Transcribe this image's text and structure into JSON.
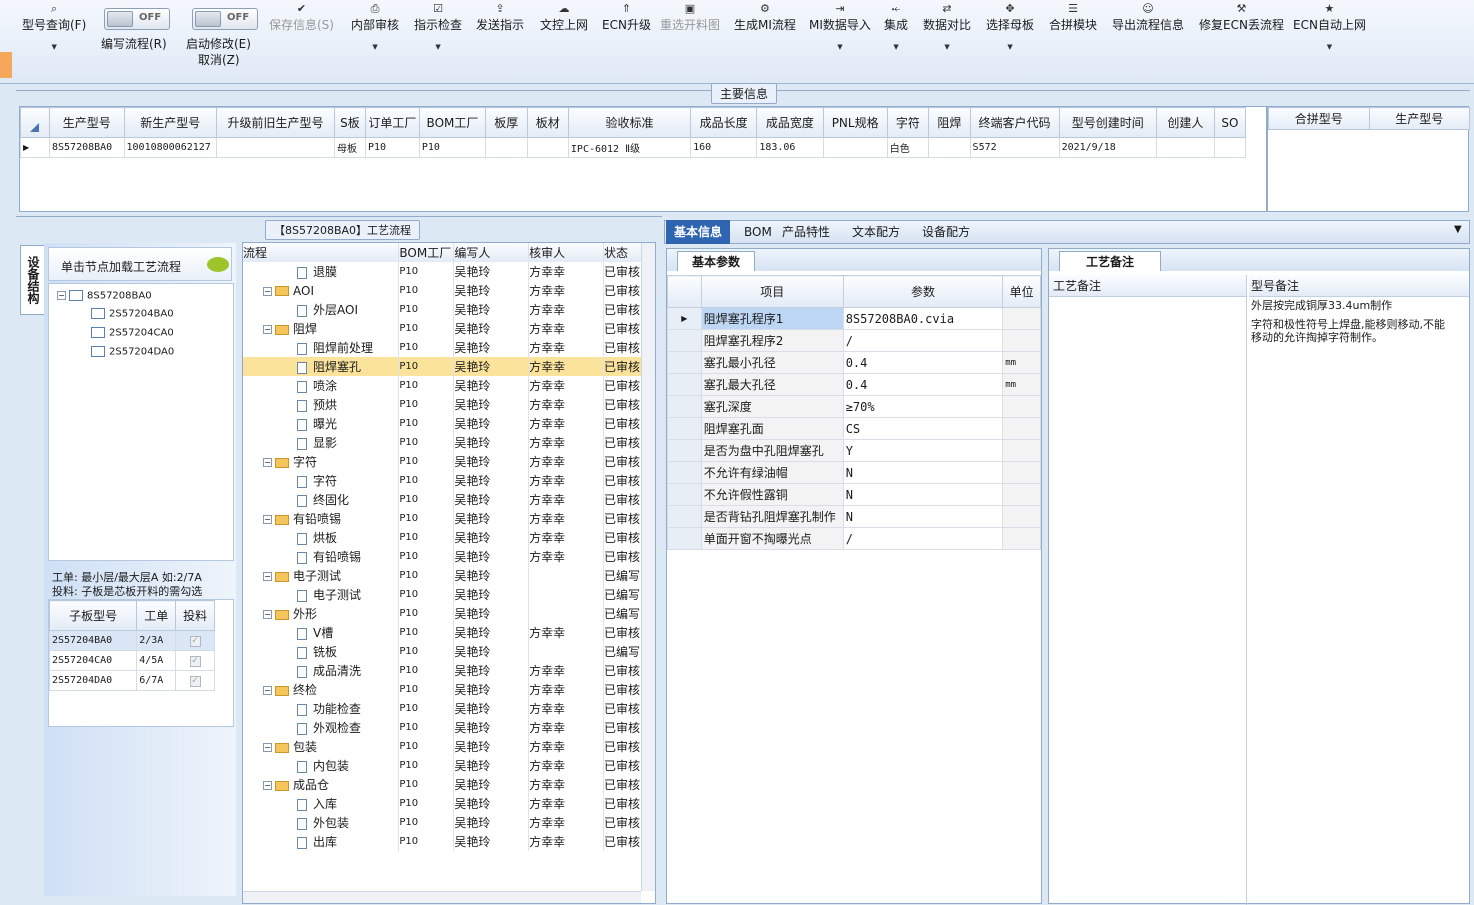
{
  "toolbar": {
    "buttons": [
      {
        "label": "型号查询(F)",
        "icon": "search-icon",
        "dropdown": true,
        "disabled": false
      },
      {
        "label": "保存信息(S)",
        "icon": "check-icon",
        "dropdown": false,
        "disabled": true
      },
      {
        "label": "内部审核",
        "icon": "printer-icon",
        "dropdown": true,
        "disabled": false
      },
      {
        "label": "指示检查",
        "icon": "checkbox-icon",
        "dropdown": true,
        "disabled": false
      },
      {
        "label": "发送指示",
        "icon": "upload-user-icon",
        "dropdown": false,
        "disabled": false
      },
      {
        "label": "文控上网",
        "icon": "cloud-upload-icon",
        "dropdown": false,
        "disabled": false
      },
      {
        "label": "ECN升级",
        "icon": "upgrade-icon",
        "dropdown": false,
        "disabled": false
      },
      {
        "label": "重选开料图",
        "icon": "image-icon",
        "dropdown": false,
        "disabled": true
      },
      {
        "label": "生成MI流程",
        "icon": "gears-icon",
        "dropdown": false,
        "disabled": false
      },
      {
        "label": "MI数据导入",
        "icon": "import-icon",
        "dropdown": true,
        "disabled": false
      },
      {
        "label": "集成",
        "icon": "merge-icon",
        "dropdown": true,
        "disabled": false
      },
      {
        "label": "数据对比",
        "icon": "compare-icon",
        "dropdown": true,
        "disabled": false
      },
      {
        "label": "选择母板",
        "icon": "select-icon",
        "dropdown": true,
        "disabled": false
      },
      {
        "label": "合拼模块",
        "icon": "list-icon",
        "dropdown": false,
        "disabled": false
      },
      {
        "label": "导出流程信息",
        "icon": "smile-icon",
        "dropdown": false,
        "disabled": false
      },
      {
        "label": "修复ECN丢流程",
        "icon": "wrench-icon",
        "dropdown": false,
        "disabled": false
      },
      {
        "label": "ECN自动上网",
        "icon": "star-icon",
        "dropdown": true,
        "disabled": false
      }
    ],
    "toggle1": {
      "state": "OFF",
      "label": "编写流程(R)"
    },
    "toggle2": {
      "state": "OFF",
      "label": "启动修改(E)",
      "sub": "取消(Z)"
    }
  },
  "main_info": {
    "title": "主要信息",
    "columns": [
      "生产型号",
      "新生产型号",
      "升级前旧生产型号",
      "S板",
      "订单工厂",
      "BOM工厂",
      "板厚",
      "板材",
      "验收标准",
      "成品长度",
      "成品宽度",
      "PNL规格",
      "字符",
      "阻焊",
      "终端客户代码",
      "型号创建时间",
      "创建人",
      "SO"
    ],
    "row": [
      "8S57208BA0",
      "10010800062127",
      "",
      "母板",
      "P10",
      "P10",
      "",
      "",
      "IPC-6012 Ⅱ级",
      "160",
      "183.06",
      "",
      "白色",
      "",
      "S572",
      "2021/9/18",
      "",
      ""
    ],
    "side_columns": [
      "合拼型号",
      "生产型号"
    ]
  },
  "process": {
    "title": "【8S57208BA0】工艺流程",
    "vertical_tab": "设备结构",
    "hint": "单击节点加载工艺流程",
    "tree": [
      "8S57208BA0",
      "2S57204BA0",
      "2S57204CA0",
      "2S57204DA0"
    ],
    "note1": "工单: 最小层/最大层A 如:2/7A",
    "note2": "投料: 子板是芯板开料的需勾选",
    "sub_columns": [
      "子板型号",
      "工单",
      "投料"
    ],
    "sub_rows": [
      [
        "2S57204BA0",
        "2/3A"
      ],
      [
        "2S57204CA0",
        "4/5A"
      ],
      [
        "2S57204DA0",
        "6/7A"
      ]
    ],
    "flow_columns": [
      "流程",
      "BOM工厂",
      "编写人",
      "核审人",
      "状态"
    ],
    "flow_rows": [
      {
        "name": "退膜",
        "level": 1,
        "bom": "P10",
        "writer": "吴艳玲",
        "checker": "方幸幸",
        "status": "已审核"
      },
      {
        "name": "AOI",
        "level": 0,
        "bom": "P10",
        "writer": "吴艳玲",
        "checker": "方幸幸",
        "status": "已审核"
      },
      {
        "name": "外层AOI",
        "level": 1,
        "bom": "P10",
        "writer": "吴艳玲",
        "checker": "方幸幸",
        "status": "已审核"
      },
      {
        "name": "阻焊",
        "level": 0,
        "bom": "P10",
        "writer": "吴艳玲",
        "checker": "方幸幸",
        "status": "已审核"
      },
      {
        "name": "阻焊前处理",
        "level": 1,
        "bom": "P10",
        "writer": "吴艳玲",
        "checker": "方幸幸",
        "status": "已审核"
      },
      {
        "name": "阻焊塞孔",
        "level": 1,
        "bom": "P10",
        "writer": "吴艳玲",
        "checker": "方幸幸",
        "status": "已审核",
        "selected": true
      },
      {
        "name": "喷涂",
        "level": 1,
        "bom": "P10",
        "writer": "吴艳玲",
        "checker": "方幸幸",
        "status": "已审核"
      },
      {
        "name": "预烘",
        "level": 1,
        "bom": "P10",
        "writer": "吴艳玲",
        "checker": "方幸幸",
        "status": "已审核"
      },
      {
        "name": "曝光",
        "level": 1,
        "bom": "P10",
        "writer": "吴艳玲",
        "checker": "方幸幸",
        "status": "已审核"
      },
      {
        "name": "显影",
        "level": 1,
        "bom": "P10",
        "writer": "吴艳玲",
        "checker": "方幸幸",
        "status": "已审核"
      },
      {
        "name": "字符",
        "level": 0,
        "bom": "P10",
        "writer": "吴艳玲",
        "checker": "方幸幸",
        "status": "已审核"
      },
      {
        "name": "字符",
        "level": 1,
        "bom": "P10",
        "writer": "吴艳玲",
        "checker": "方幸幸",
        "status": "已审核"
      },
      {
        "name": "终固化",
        "level": 1,
        "bom": "P10",
        "writer": "吴艳玲",
        "checker": "方幸幸",
        "status": "已审核"
      },
      {
        "name": "有铅喷锡",
        "level": 0,
        "bom": "P10",
        "writer": "吴艳玲",
        "checker": "方幸幸",
        "status": "已审核"
      },
      {
        "name": "烘板",
        "level": 1,
        "bom": "P10",
        "writer": "吴艳玲",
        "checker": "方幸幸",
        "status": "已审核"
      },
      {
        "name": "有铅喷锡",
        "level": 1,
        "bom": "P10",
        "writer": "吴艳玲",
        "checker": "方幸幸",
        "status": "已审核"
      },
      {
        "name": "电子测试",
        "level": 0,
        "bom": "P10",
        "writer": "吴艳玲",
        "checker": "",
        "status": "已编写"
      },
      {
        "name": "电子测试",
        "level": 1,
        "bom": "P10",
        "writer": "吴艳玲",
        "checker": "",
        "status": "已编写"
      },
      {
        "name": "外形",
        "level": 0,
        "bom": "P10",
        "writer": "吴艳玲",
        "checker": "",
        "status": "已编写"
      },
      {
        "name": "V槽",
        "level": 1,
        "bom": "P10",
        "writer": "吴艳玲",
        "checker": "方幸幸",
        "status": "已审核"
      },
      {
        "name": "铣板",
        "level": 1,
        "bom": "P10",
        "writer": "吴艳玲",
        "checker": "",
        "status": "已编写"
      },
      {
        "name": "成品清洗",
        "level": 1,
        "bom": "P10",
        "writer": "吴艳玲",
        "checker": "方幸幸",
        "status": "已审核"
      },
      {
        "name": "终检",
        "level": 0,
        "bom": "P10",
        "writer": "吴艳玲",
        "checker": "方幸幸",
        "status": "已审核"
      },
      {
        "name": "功能检查",
        "level": 1,
        "bom": "P10",
        "writer": "吴艳玲",
        "checker": "方幸幸",
        "status": "已审核"
      },
      {
        "name": "外观检查",
        "level": 1,
        "bom": "P10",
        "writer": "吴艳玲",
        "checker": "方幸幸",
        "status": "已审核"
      },
      {
        "name": "包装",
        "level": 0,
        "bom": "P10",
        "writer": "吴艳玲",
        "checker": "方幸幸",
        "status": "已审核"
      },
      {
        "name": "内包装",
        "level": 1,
        "bom": "P10",
        "writer": "吴艳玲",
        "checker": "方幸幸",
        "status": "已审核"
      },
      {
        "name": "成品仓",
        "level": 0,
        "bom": "P10",
        "writer": "吴艳玲",
        "checker": "方幸幸",
        "status": "已审核"
      },
      {
        "name": "入库",
        "level": 1,
        "bom": "P10",
        "writer": "吴艳玲",
        "checker": "方幸幸",
        "status": "已审核"
      },
      {
        "name": "外包装",
        "level": 1,
        "bom": "P10",
        "writer": "吴艳玲",
        "checker": "方幸幸",
        "status": "已审核"
      },
      {
        "name": "出库",
        "level": 1,
        "bom": "P10",
        "writer": "吴艳玲",
        "checker": "方幸幸",
        "status": "已审核"
      }
    ]
  },
  "detail": {
    "tabs": [
      "基本信息",
      "BOM",
      "产品特性",
      "文本配方",
      "设备配方"
    ],
    "subtab": "基本参数",
    "columns": [
      "项目",
      "参数",
      "单位"
    ],
    "rows": [
      [
        "阻焊塞孔程序1",
        "8S57208BA0.cvia",
        ""
      ],
      [
        "阻焊塞孔程序2",
        "/",
        ""
      ],
      [
        "塞孔最小孔径",
        "0.4",
        "mm"
      ],
      [
        "塞孔最大孔径",
        "0.4",
        "mm"
      ],
      [
        "塞孔深度",
        "≥70%",
        ""
      ],
      [
        "阻焊塞孔面",
        "CS",
        ""
      ],
      [
        "是否为盘中孔阻焊塞孔",
        "Y",
        ""
      ],
      [
        "不允许有绿油帽",
        "N",
        ""
      ],
      [
        "不允许假性露铜",
        "N",
        ""
      ],
      [
        "是否背钻孔阻焊塞孔制作",
        "N",
        ""
      ],
      [
        "单面开窗不掏曝光点",
        "/",
        ""
      ]
    ]
  },
  "remarks": {
    "tab": "工艺备注",
    "col1": "工艺备注",
    "col2": "型号备注",
    "line1": "外层按完成铜厚33.4um制作",
    "line2": "字符和极性符号上焊盘,能移则移动,不能移动的允许掏掉字符制作。"
  },
  "colors": {
    "accent": "#3d6fb6",
    "selected_row": "#fbe39c",
    "tab_active": "#2f64b0"
  }
}
